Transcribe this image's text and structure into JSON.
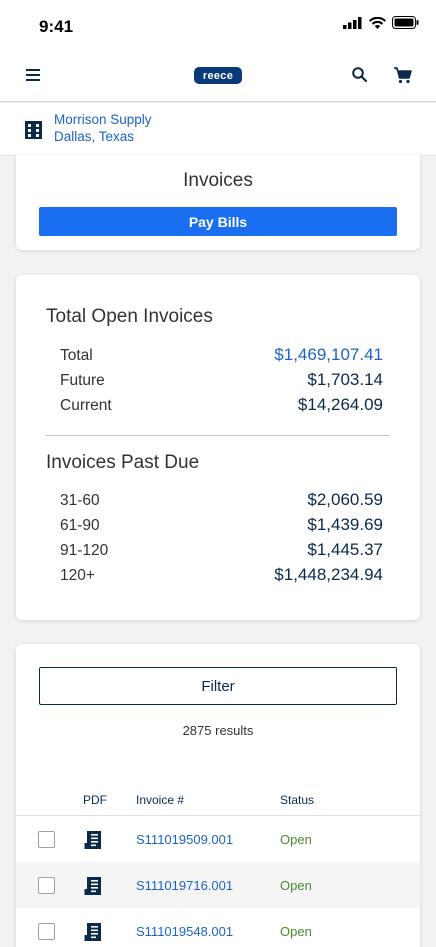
{
  "status_bar": {
    "time": "9:41"
  },
  "header": {
    "logo_text": "reece",
    "icons": [
      "menu-icon",
      "search-icon",
      "cart-icon"
    ]
  },
  "location": {
    "name": "Morrison Supply",
    "city": "Dallas, Texas",
    "icon": "building-icon"
  },
  "invoices_card": {
    "title": "Invoices",
    "pay_button": "Pay Bills"
  },
  "open_invoices": {
    "title": "Total Open Invoices",
    "rows": [
      {
        "label": "Total",
        "value": "$1,469,107.41"
      },
      {
        "label": "Future",
        "value": "$1,703.14"
      },
      {
        "label": "Current",
        "value": "$14,264.09"
      }
    ]
  },
  "past_due": {
    "title": "Invoices Past Due",
    "rows": [
      {
        "label": "31-60",
        "value": "$2,060.59"
      },
      {
        "label": "61-90",
        "value": "$1,439.69"
      },
      {
        "label": "91-120",
        "value": "$1,445.37"
      },
      {
        "label": "120+",
        "value": "$1,448,234.94"
      }
    ]
  },
  "list": {
    "filter_label": "Filter",
    "results": "2875 results",
    "columns": [
      "PDF",
      "Invoice #",
      "Status"
    ],
    "rows": [
      {
        "invoice": "S111019509.001",
        "status": "Open"
      },
      {
        "invoice": "S111019716.001",
        "status": "Open"
      },
      {
        "invoice": "S111019548.001",
        "status": "Open"
      }
    ]
  },
  "colors": {
    "brand": "#0b3a78",
    "primary": "#1a6ff0",
    "link": "#1c63c7",
    "status_open": "#4f8a2e"
  }
}
